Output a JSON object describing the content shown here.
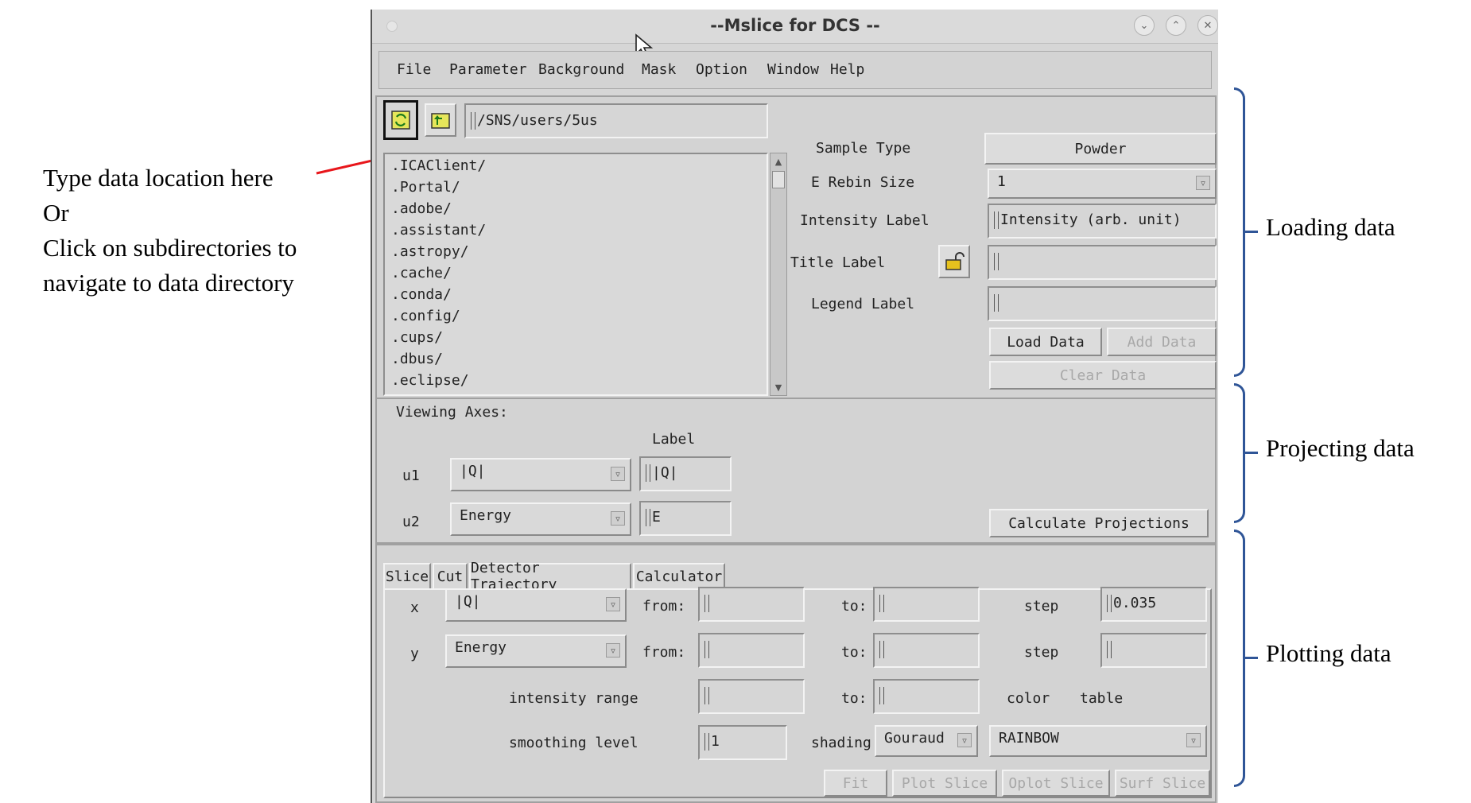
{
  "annotations": {
    "left": [
      "Type data location here",
      "Or",
      "Click on subdirectories to",
      "navigate to data directory"
    ],
    "right": {
      "loading": "Loading data",
      "projecting": "Projecting data",
      "plotting": "Plotting data"
    },
    "arrow_color": "#e8161b",
    "bracket_color": "#2f5597"
  },
  "window": {
    "title": "--Mslice for DCS --",
    "controls": [
      "chevron-down-icon",
      "chevron-up-icon",
      "close-icon"
    ]
  },
  "menu": [
    "File",
    "Parameter",
    "Background",
    "Mask",
    "Option",
    "Window",
    "Help"
  ],
  "loading": {
    "path": "/SNS/users/5us",
    "files": [
      ".ICAClient/",
      ".Portal/",
      ".adobe/",
      ".assistant/",
      ".astropy/",
      ".cache/",
      ".conda/",
      ".config/",
      ".cups/",
      ".dbus/",
      ".eclipse/"
    ],
    "sample_type_label": "Sample Type",
    "sample_type_value": "Powder",
    "e_rebin_label": "E Rebin Size",
    "e_rebin_value": "1",
    "intensity_label": "Intensity Label",
    "intensity_value": "Intensity (arb. unit)",
    "title_label": "Title Label",
    "title_value": "",
    "legend_label": "Legend Label",
    "legend_value": "",
    "load_data": "Load Data",
    "add_data": "Add Data",
    "clear_data": "Clear Data"
  },
  "projecting": {
    "viewing_axes": "Viewing Axes:",
    "label_header": "Label",
    "u1": {
      "name": "u1",
      "value": "|Q|",
      "label": "|Q|"
    },
    "u2": {
      "name": "u2",
      "value": "Energy",
      "label": "E"
    },
    "calculate": "Calculate Projections"
  },
  "plotting": {
    "tabs": [
      "Slice",
      "Cut",
      "Detector Trajectory",
      "Calculator"
    ],
    "x": {
      "name": "x",
      "value": "|Q|",
      "from": "from:",
      "to": "to:",
      "step_label": "step",
      "step": "0.035"
    },
    "y": {
      "name": "y",
      "value": "Energy",
      "from": "from:",
      "to": "to:",
      "step_label": "step",
      "step": ""
    },
    "intensity_range": "intensity range",
    "intensity_to": "to:",
    "color": "color",
    "table": "table",
    "smoothing": "smoothing level",
    "smoothing_value": "1",
    "shading_label": "shading",
    "shading_value": "Gouraud",
    "colortable_value": "RAINBOW",
    "buttons": [
      "Fit",
      "Plot Slice",
      "Oplot Slice",
      "Surf Slice"
    ]
  }
}
